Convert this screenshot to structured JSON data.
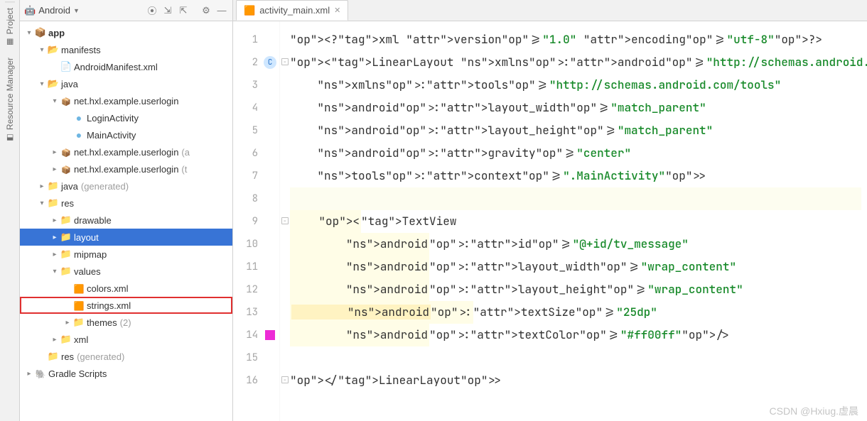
{
  "side_tools": {
    "project": "Project",
    "res_mgr": "Resource Manager"
  },
  "panel": {
    "title": "Android",
    "icons": [
      "target",
      "collapse",
      "expand",
      "settings",
      "minimize"
    ]
  },
  "tree": [
    {
      "d": 0,
      "arrow": "down",
      "icon": "ic-app",
      "label": "app",
      "bold": true
    },
    {
      "d": 1,
      "arrow": "down",
      "icon": "ic-folder-blue",
      "label": "manifests"
    },
    {
      "d": 2,
      "arrow": "none",
      "icon": "ic-mf",
      "label": "AndroidManifest.xml"
    },
    {
      "d": 1,
      "arrow": "down",
      "icon": "ic-folder-blue",
      "label": "java"
    },
    {
      "d": 2,
      "arrow": "down",
      "icon": "ic-pkg",
      "label": "net.hxl.example.userlogin"
    },
    {
      "d": 3,
      "arrow": "none",
      "icon": "ic-class",
      "label": "LoginActivity"
    },
    {
      "d": 3,
      "arrow": "none",
      "icon": "ic-class",
      "label": "MainActivity"
    },
    {
      "d": 2,
      "arrow": "right",
      "icon": "ic-pkg",
      "label": "net.hxl.example.userlogin",
      "suffix": "(a"
    },
    {
      "d": 2,
      "arrow": "right",
      "icon": "ic-pkg",
      "label": "net.hxl.example.userlogin",
      "suffix": "(t"
    },
    {
      "d": 1,
      "arrow": "right",
      "icon": "ic-folder",
      "label": "java",
      "gen": "(generated)"
    },
    {
      "d": 1,
      "arrow": "down",
      "icon": "ic-folder",
      "label": "res"
    },
    {
      "d": 2,
      "arrow": "right",
      "icon": "ic-folder",
      "label": "drawable"
    },
    {
      "d": 2,
      "arrow": "right",
      "icon": "ic-folder",
      "label": "layout",
      "selected": true
    },
    {
      "d": 2,
      "arrow": "right",
      "icon": "ic-folder",
      "label": "mipmap"
    },
    {
      "d": 2,
      "arrow": "down",
      "icon": "ic-folder",
      "label": "values"
    },
    {
      "d": 3,
      "arrow": "none",
      "icon": "ic-xml",
      "label": "colors.xml"
    },
    {
      "d": 3,
      "arrow": "none",
      "icon": "ic-xml",
      "label": "strings.xml",
      "boxed": true
    },
    {
      "d": 3,
      "arrow": "right",
      "icon": "ic-folder",
      "label": "themes",
      "gen": "(2)"
    },
    {
      "d": 2,
      "arrow": "right",
      "icon": "ic-folder",
      "label": "xml"
    },
    {
      "d": 1,
      "arrow": "none",
      "icon": "ic-folder",
      "label": "res",
      "gen": "(generated)"
    },
    {
      "d": 0,
      "arrow": "right",
      "icon": "ic-gradle",
      "label": "Gradle Scripts"
    }
  ],
  "tab": {
    "label": "activity_main.xml"
  },
  "code": {
    "lines": [
      "<?xml version=\"1.0\" encoding=\"utf-8\"?>",
      "<LinearLayout xmlns:android=\"http://schemas.android.com/apk/res/android\"",
      "    xmlns:tools=\"http://schemas.android.com/tools\"",
      "    android:layout_width=\"match_parent\"",
      "    android:layout_height=\"match_parent\"",
      "    android:gravity=\"center\"",
      "    tools:context=\".MainActivity\">",
      "",
      "    <TextView",
      "        android:id=\"@+id/tv_message\"",
      "        android:layout_width=\"wrap_content\"",
      "        android:layout_height=\"wrap_content\"",
      "        android:textSize=\"25dp\"",
      "        android:textColor=\"#ff00ff\"/>",
      "",
      "</LinearLayout>"
    ]
  },
  "watermark": "CSDN @Hxiug.虚晨"
}
